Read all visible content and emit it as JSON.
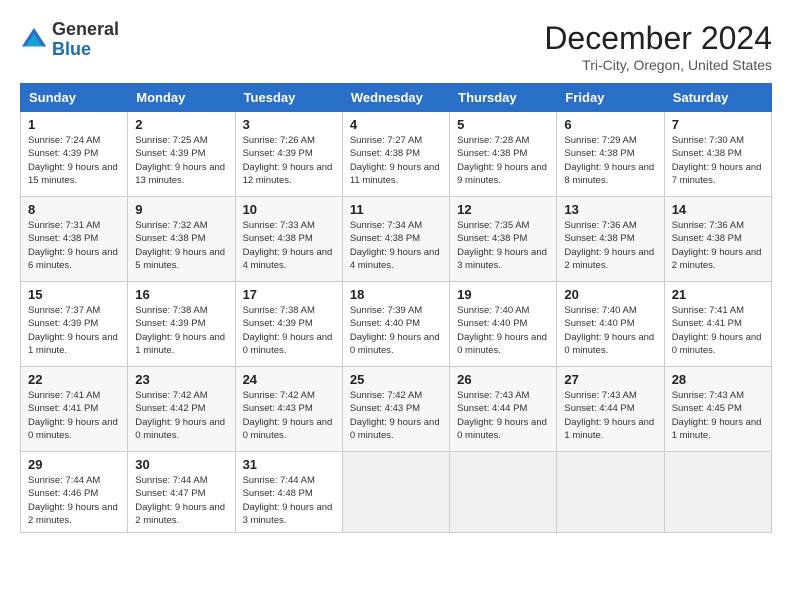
{
  "logo": {
    "general": "General",
    "blue": "Blue"
  },
  "title": "December 2024",
  "location": "Tri-City, Oregon, United States",
  "days_of_week": [
    "Sunday",
    "Monday",
    "Tuesday",
    "Wednesday",
    "Thursday",
    "Friday",
    "Saturday"
  ],
  "weeks": [
    [
      {
        "day": "1",
        "sunrise": "7:24 AM",
        "sunset": "4:39 PM",
        "daylight": "9 hours and 15 minutes."
      },
      {
        "day": "2",
        "sunrise": "7:25 AM",
        "sunset": "4:39 PM",
        "daylight": "9 hours and 13 minutes."
      },
      {
        "day": "3",
        "sunrise": "7:26 AM",
        "sunset": "4:39 PM",
        "daylight": "9 hours and 12 minutes."
      },
      {
        "day": "4",
        "sunrise": "7:27 AM",
        "sunset": "4:38 PM",
        "daylight": "9 hours and 11 minutes."
      },
      {
        "day": "5",
        "sunrise": "7:28 AM",
        "sunset": "4:38 PM",
        "daylight": "9 hours and 9 minutes."
      },
      {
        "day": "6",
        "sunrise": "7:29 AM",
        "sunset": "4:38 PM",
        "daylight": "9 hours and 8 minutes."
      },
      {
        "day": "7",
        "sunrise": "7:30 AM",
        "sunset": "4:38 PM",
        "daylight": "9 hours and 7 minutes."
      }
    ],
    [
      {
        "day": "8",
        "sunrise": "7:31 AM",
        "sunset": "4:38 PM",
        "daylight": "9 hours and 6 minutes."
      },
      {
        "day": "9",
        "sunrise": "7:32 AM",
        "sunset": "4:38 PM",
        "daylight": "9 hours and 5 minutes."
      },
      {
        "day": "10",
        "sunrise": "7:33 AM",
        "sunset": "4:38 PM",
        "daylight": "9 hours and 4 minutes."
      },
      {
        "day": "11",
        "sunrise": "7:34 AM",
        "sunset": "4:38 PM",
        "daylight": "9 hours and 4 minutes."
      },
      {
        "day": "12",
        "sunrise": "7:35 AM",
        "sunset": "4:38 PM",
        "daylight": "9 hours and 3 minutes."
      },
      {
        "day": "13",
        "sunrise": "7:36 AM",
        "sunset": "4:38 PM",
        "daylight": "9 hours and 2 minutes."
      },
      {
        "day": "14",
        "sunrise": "7:36 AM",
        "sunset": "4:38 PM",
        "daylight": "9 hours and 2 minutes."
      }
    ],
    [
      {
        "day": "15",
        "sunrise": "7:37 AM",
        "sunset": "4:39 PM",
        "daylight": "9 hours and 1 minute."
      },
      {
        "day": "16",
        "sunrise": "7:38 AM",
        "sunset": "4:39 PM",
        "daylight": "9 hours and 1 minute."
      },
      {
        "day": "17",
        "sunrise": "7:38 AM",
        "sunset": "4:39 PM",
        "daylight": "9 hours and 0 minutes."
      },
      {
        "day": "18",
        "sunrise": "7:39 AM",
        "sunset": "4:40 PM",
        "daylight": "9 hours and 0 minutes."
      },
      {
        "day": "19",
        "sunrise": "7:40 AM",
        "sunset": "4:40 PM",
        "daylight": "9 hours and 0 minutes."
      },
      {
        "day": "20",
        "sunrise": "7:40 AM",
        "sunset": "4:40 PM",
        "daylight": "9 hours and 0 minutes."
      },
      {
        "day": "21",
        "sunrise": "7:41 AM",
        "sunset": "4:41 PM",
        "daylight": "9 hours and 0 minutes."
      }
    ],
    [
      {
        "day": "22",
        "sunrise": "7:41 AM",
        "sunset": "4:41 PM",
        "daylight": "9 hours and 0 minutes."
      },
      {
        "day": "23",
        "sunrise": "7:42 AM",
        "sunset": "4:42 PM",
        "daylight": "9 hours and 0 minutes."
      },
      {
        "day": "24",
        "sunrise": "7:42 AM",
        "sunset": "4:43 PM",
        "daylight": "9 hours and 0 minutes."
      },
      {
        "day": "25",
        "sunrise": "7:42 AM",
        "sunset": "4:43 PM",
        "daylight": "9 hours and 0 minutes."
      },
      {
        "day": "26",
        "sunrise": "7:43 AM",
        "sunset": "4:44 PM",
        "daylight": "9 hours and 0 minutes."
      },
      {
        "day": "27",
        "sunrise": "7:43 AM",
        "sunset": "4:44 PM",
        "daylight": "9 hours and 1 minute."
      },
      {
        "day": "28",
        "sunrise": "7:43 AM",
        "sunset": "4:45 PM",
        "daylight": "9 hours and 1 minute."
      }
    ],
    [
      {
        "day": "29",
        "sunrise": "7:44 AM",
        "sunset": "4:46 PM",
        "daylight": "9 hours and 2 minutes."
      },
      {
        "day": "30",
        "sunrise": "7:44 AM",
        "sunset": "4:47 PM",
        "daylight": "9 hours and 2 minutes."
      },
      {
        "day": "31",
        "sunrise": "7:44 AM",
        "sunset": "4:48 PM",
        "daylight": "9 hours and 3 minutes."
      },
      null,
      null,
      null,
      null
    ]
  ],
  "labels": {
    "sunrise": "Sunrise:",
    "sunset": "Sunset:",
    "daylight": "Daylight:"
  }
}
